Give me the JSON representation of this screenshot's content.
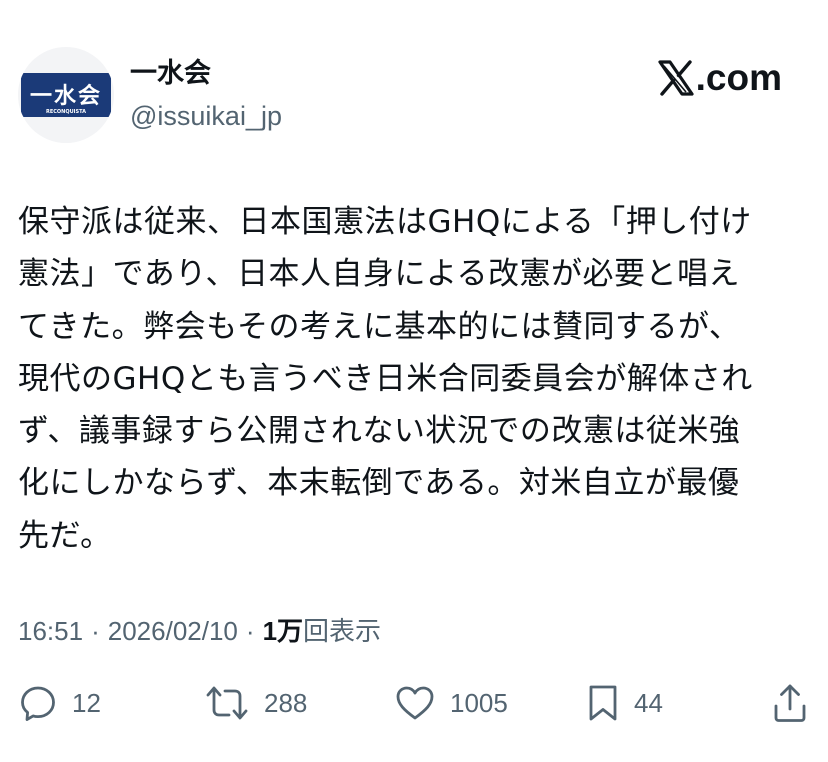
{
  "account": {
    "display_name": "一水会",
    "handle": "@issuikai_jp",
    "avatar_text": "一水会",
    "avatar_subtext": "RECONQUISTA"
  },
  "brand": {
    "label": ".com",
    "icon": "x-logo-icon"
  },
  "post": {
    "lines": [
      "保守派は従来、日本国憲法はGHQによる「押し付け",
      "憲法」であり、日本人自身による改憲が必要と唱え",
      "てきた。弊会もその考えに基本的には賛同するが、",
      "現代のGHQとも言うべき日米合同委員会が解体され",
      "ず、議事録すら公開されない状況での改憲は従米強",
      "化にしかならず、本末転倒である。対米自立が最優",
      "先だ。"
    ]
  },
  "meta": {
    "time": "16:51",
    "separator": "·",
    "date": "2026/02/10",
    "views_count": "1万",
    "views_label": "回表示"
  },
  "actions": {
    "replies": "12",
    "reposts": "288",
    "likes": "1005",
    "bookmarks": "44"
  },
  "colors": {
    "text": "#0f1419",
    "secondary": "#536471",
    "avatar_bg": "#1b3a78"
  }
}
